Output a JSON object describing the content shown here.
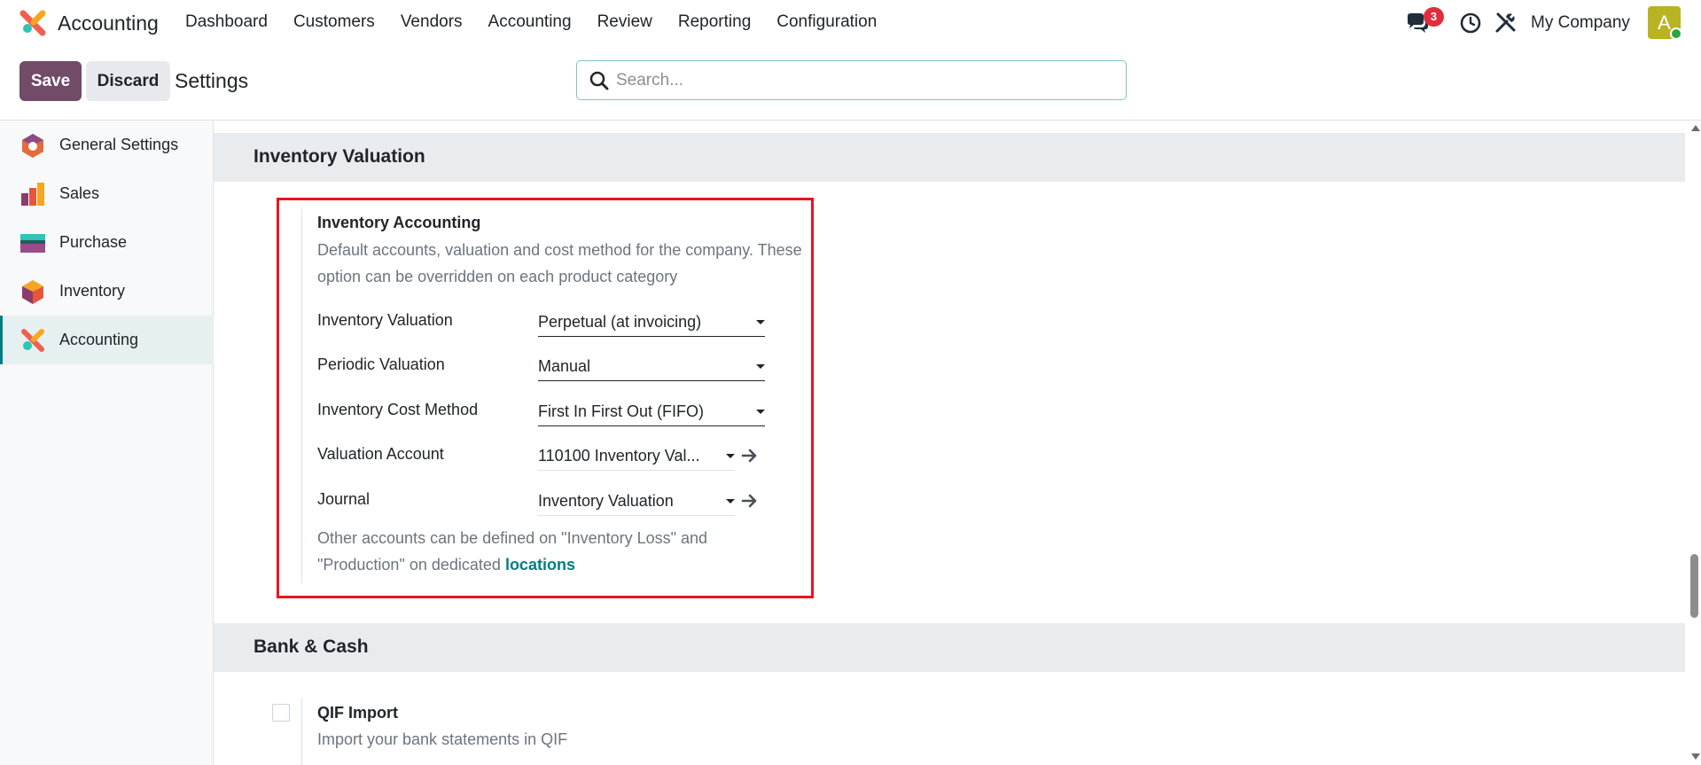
{
  "navbar": {
    "app_name": "Accounting",
    "menu": [
      "Dashboard",
      "Customers",
      "Vendors",
      "Accounting",
      "Review",
      "Reporting",
      "Configuration"
    ],
    "chat_count": "3",
    "company": "My Company",
    "avatar_letter": "A"
  },
  "control": {
    "save_label": "Save",
    "discard_label": "Discard",
    "title": "Settings",
    "search_placeholder": "Search..."
  },
  "sidebar": {
    "items": [
      {
        "label": "General Settings",
        "icon": "general-settings-icon"
      },
      {
        "label": "Sales",
        "icon": "sales-icon"
      },
      {
        "label": "Purchase",
        "icon": "purchase-icon"
      },
      {
        "label": "Inventory",
        "icon": "inventory-icon"
      },
      {
        "label": "Accounting",
        "icon": "accounting-icon",
        "active": true
      }
    ]
  },
  "inventory_section": {
    "header": "Inventory Valuation",
    "setting_title": "Inventory Accounting",
    "description": "Default accounts, valuation and cost method for the company. These option can be overridden on each product category",
    "rows": [
      {
        "label": "Inventory Valuation",
        "value": "Perpetual (at invoicing)"
      },
      {
        "label": "Periodic Valuation",
        "value": "Manual"
      },
      {
        "label": "Inventory Cost Method",
        "value": "First In First Out (FIFO)"
      },
      {
        "label": "Valuation Account",
        "value": "110100 Inventory Val..."
      },
      {
        "label": "Journal",
        "value": "Inventory Valuation"
      }
    ],
    "footer_text": "Other accounts can be defined on \"Inventory Loss\" and \"Production\" on dedicated",
    "footer_link": "locations"
  },
  "bank_section": {
    "header": "Bank & Cash",
    "qif_title": "QIF Import",
    "qif_desc": "Import your bank statements in QIF"
  },
  "colors": {
    "brand": "#714b67",
    "accent": "#017e84",
    "highlight": "#e8141e",
    "badge": "#e02e3c"
  }
}
